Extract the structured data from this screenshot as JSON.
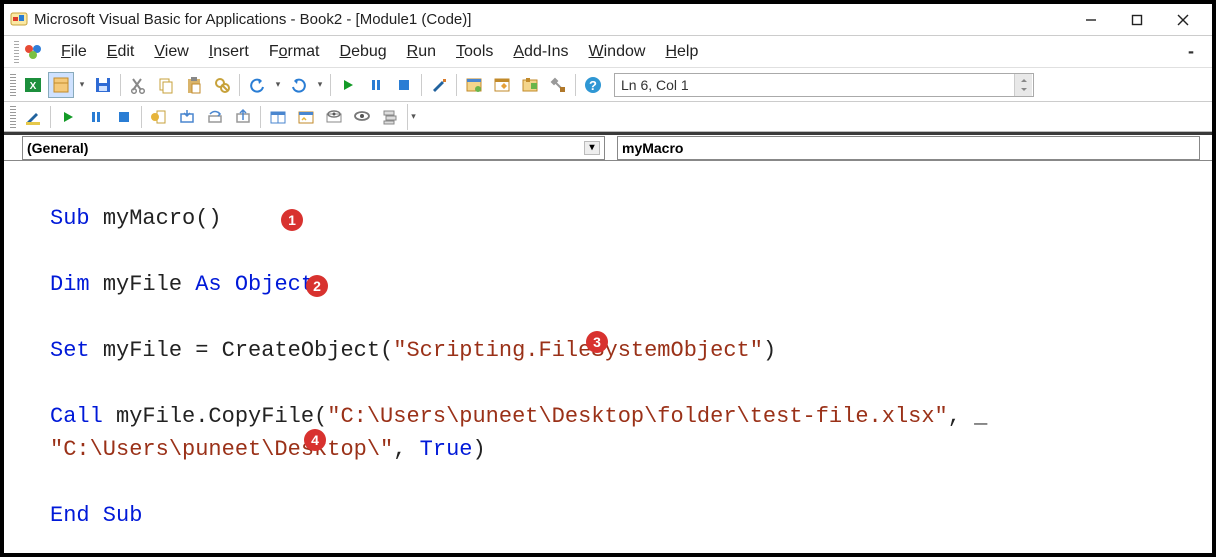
{
  "title": "Microsoft Visual Basic for Applications - Book2 - [Module1 (Code)]",
  "menus": {
    "file": "File",
    "edit": "Edit",
    "view": "View",
    "insert": "Insert",
    "format": "Format",
    "debug": "Debug",
    "run": "Run",
    "tools": "Tools",
    "addins": "Add-Ins",
    "window": "Window",
    "help": "Help"
  },
  "status": {
    "position": "Ln 6, Col 1"
  },
  "dropdowns": {
    "object": "(General)",
    "procedure": "myMacro"
  },
  "callouts": {
    "c1": "1",
    "c2": "2",
    "c3": "3",
    "c4": "4"
  },
  "code": {
    "l1_kw": "Sub ",
    "l1_rest": "myMacro()",
    "l3_kw1": "Dim ",
    "l3_mid": "myFile ",
    "l3_kw2": "As Object",
    "l5_kw": "Set ",
    "l5_mid": "myFile = CreateObject(",
    "l5_str": "\"Scripting.FileSystemObject\"",
    "l5_end": ")",
    "l7_kw": "Call ",
    "l7_mid": "myFile.CopyFile(",
    "l7_str": "\"C:\\Users\\puneet\\Desktop\\folder\\test-file.xlsx\"",
    "l7_end": ", _",
    "l8_str": "\"C:\\Users\\puneet\\Desktop\\\"",
    "l8_mid": ", ",
    "l8_kw": "True",
    "l8_end": ")",
    "l10_kw": "End Sub"
  }
}
